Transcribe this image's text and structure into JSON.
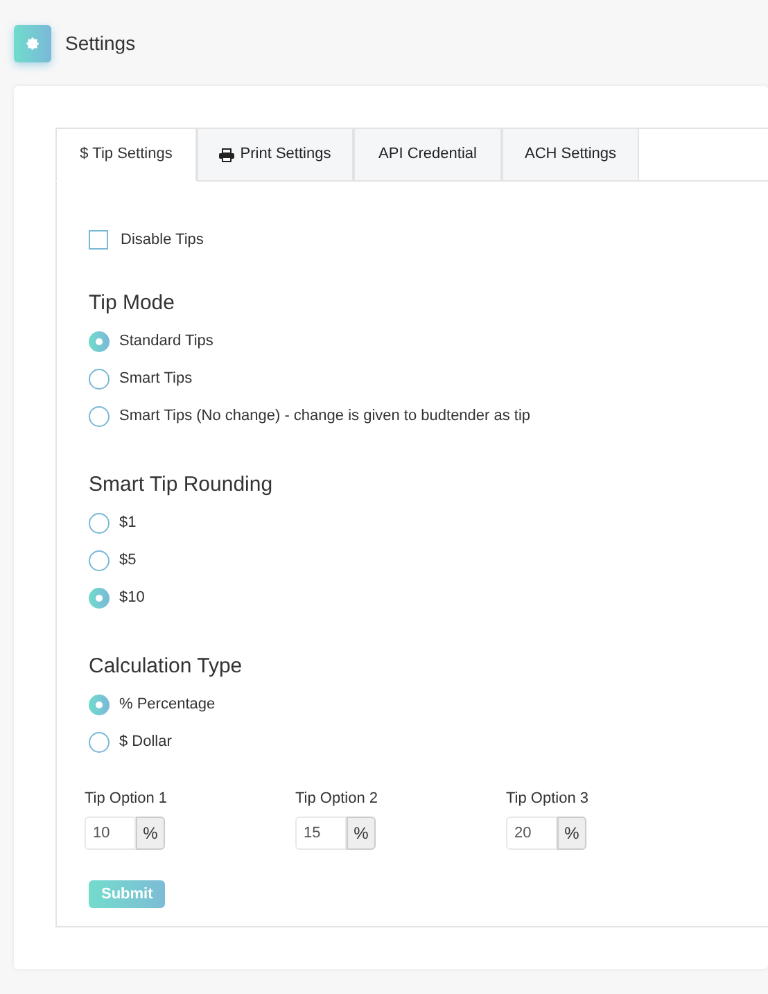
{
  "header": {
    "title": "Settings"
  },
  "tabs": [
    {
      "label": "$ Tip Settings",
      "kind": "plain",
      "selected": true
    },
    {
      "label": "Print Settings",
      "kind": "print",
      "selected": false
    },
    {
      "label": "API Credential",
      "kind": "plain",
      "selected": false
    },
    {
      "label": "ACH Settings",
      "kind": "plain",
      "selected": false
    }
  ],
  "disable_tips": {
    "label": "Disable Tips",
    "checked": false
  },
  "groups": [
    {
      "title": "Tip Mode",
      "options": [
        {
          "label": "Standard Tips",
          "selected": true
        },
        {
          "label": "Smart Tips",
          "selected": false
        },
        {
          "label": "Smart Tips (No change) - change is given to budtender as tip",
          "selected": false
        }
      ]
    },
    {
      "title": "Smart Tip Rounding",
      "options": [
        {
          "label": "$1",
          "selected": false
        },
        {
          "label": "$5",
          "selected": false
        },
        {
          "label": "$10",
          "selected": true
        }
      ]
    },
    {
      "title": "Calculation Type",
      "options": [
        {
          "label": "% Percentage",
          "selected": true
        },
        {
          "label": "$ Dollar",
          "selected": false
        }
      ]
    }
  ],
  "tip_options": [
    {
      "label": "Tip Option 1",
      "value": "10",
      "unit": "%"
    },
    {
      "label": "Tip Option 2",
      "value": "15",
      "unit": "%"
    },
    {
      "label": "Tip Option 3",
      "value": "20",
      "unit": "%"
    }
  ],
  "submit": "Submit"
}
